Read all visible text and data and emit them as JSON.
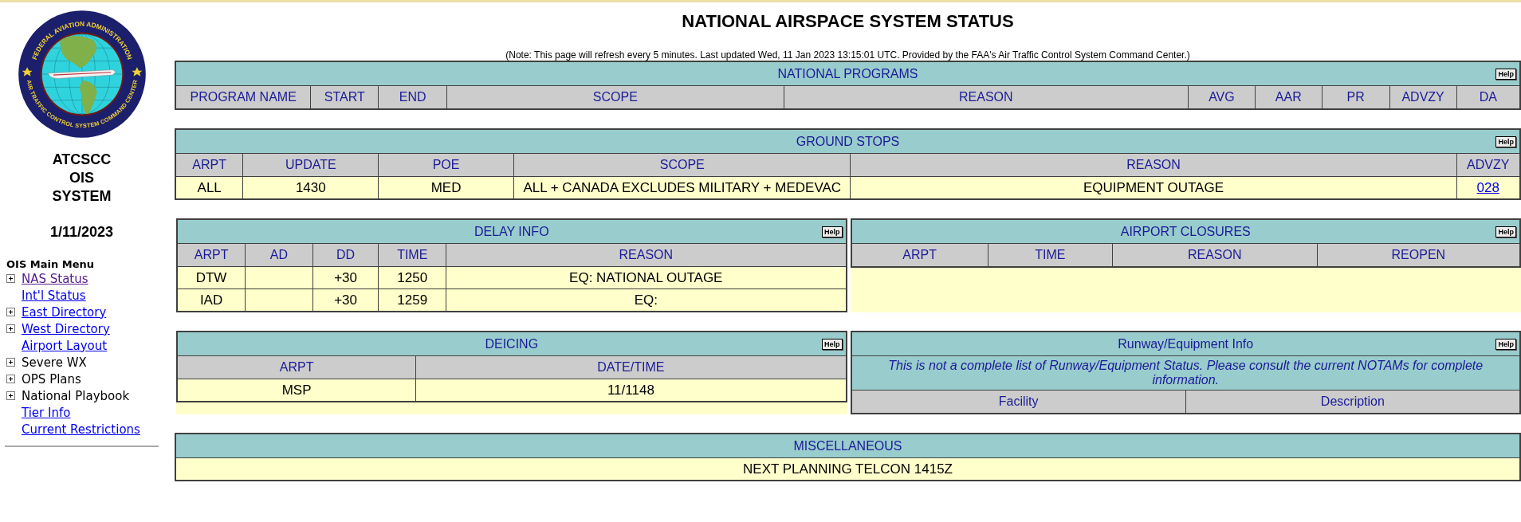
{
  "title": "NATIONAL AIRSPACE SYSTEM STATUS",
  "note": "(Note: This page will refresh every 5 minutes.  Last updated Wed, 11 Jan 2023 13:15:01 UTC.  Provided by the FAA's Air Traffic Control System Command Center.)",
  "sidebar": {
    "seal_top": "FEDERAL AVIATION ADMINISTRATION",
    "seal_bottom": "AIR TRAFFIC CONTROL SYSTEM COMMAND CENTER",
    "system_lines": [
      "ATCSCC",
      "OIS",
      "SYSTEM"
    ],
    "date": "1/11/2023",
    "menu_title": "OIS Main Menu",
    "menu_items": [
      {
        "label": "NAS Status",
        "kind": "link",
        "expandable": true,
        "visited": true
      },
      {
        "label": "Int'l Status",
        "kind": "link",
        "expandable": false,
        "visited": false
      },
      {
        "label": "East Directory",
        "kind": "link",
        "expandable": true,
        "visited": false
      },
      {
        "label": "West Directory",
        "kind": "link",
        "expandable": true,
        "visited": false
      },
      {
        "label": "Airport Layout",
        "kind": "link",
        "expandable": false,
        "visited": false
      },
      {
        "label": "Severe WX",
        "kind": "text",
        "expandable": true
      },
      {
        "label": "OPS Plans",
        "kind": "text",
        "expandable": true
      },
      {
        "label": "National Playbook",
        "kind": "text",
        "expandable": true
      },
      {
        "label": "Tier Info",
        "kind": "link",
        "expandable": false,
        "visited": false
      },
      {
        "label": "Current Restrictions",
        "kind": "link",
        "expandable": false,
        "visited": false
      }
    ]
  },
  "national_programs": {
    "title": "NATIONAL PROGRAMS",
    "help": "Help",
    "columns": [
      "PROGRAM NAME",
      "START",
      "END",
      "SCOPE",
      "REASON",
      "AVG",
      "AAR",
      "PR",
      "ADVZY",
      "DA"
    ]
  },
  "ground_stops": {
    "title": "GROUND STOPS",
    "help": "Help",
    "columns": [
      "ARPT",
      "UPDATE",
      "POE",
      "SCOPE",
      "REASON",
      "ADVZY"
    ],
    "rows": [
      [
        "ALL",
        "1430",
        "MED",
        "ALL + CANADA EXCLUDES MILITARY + MEDEVAC",
        "EQUIPMENT OUTAGE",
        {
          "text": "028",
          "kind": "link"
        }
      ]
    ]
  },
  "delay_info": {
    "title": "DELAY INFO",
    "help": "Help",
    "columns": [
      "ARPT",
      "AD",
      "DD",
      "TIME",
      "REASON"
    ],
    "rows": [
      [
        "DTW",
        "",
        "+30",
        "1250",
        "EQ: NATIONAL OUTAGE"
      ],
      [
        "IAD",
        "",
        "+30",
        "1259",
        "EQ:"
      ]
    ]
  },
  "airport_closures": {
    "title": "AIRPORT CLOSURES",
    "help": "Help",
    "columns": [
      "ARPT",
      "TIME",
      "REASON",
      "REOPEN"
    ]
  },
  "deicing": {
    "title": "DEICING",
    "help": "Help",
    "columns": [
      "ARPT",
      "DATE/TIME"
    ],
    "rows": [
      [
        "MSP",
        "11/1148"
      ]
    ]
  },
  "runway_equipment": {
    "title": "Runway/Equipment Info",
    "help": "Help",
    "notice": "This is not a complete list of Runway/Equipment Status. Please consult the current NOTAMs for complete information.",
    "columns": [
      "Facility",
      "Description"
    ]
  },
  "miscellaneous": {
    "title": "MISCELLANEOUS",
    "rows": [
      [
        "NEXT PLANNING TELCON 1415Z"
      ]
    ]
  }
}
